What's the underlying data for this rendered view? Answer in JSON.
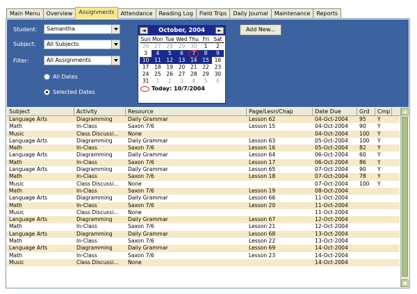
{
  "tabs": [
    {
      "label": "Main Menu"
    },
    {
      "label": "Overview"
    },
    {
      "label": "Assignments",
      "active": true
    },
    {
      "label": "Attendance"
    },
    {
      "label": "Reading Log"
    },
    {
      "label": "Field Trips"
    },
    {
      "label": "Daily Journal"
    },
    {
      "label": "Maintenance"
    },
    {
      "label": "Reports"
    }
  ],
  "filters": {
    "student_label": "Student:",
    "student_value": "Samantha",
    "subject_label": "Subject:",
    "subject_value": "All Subjects",
    "filter_label": "Filter:",
    "filter_value": "All Assignments",
    "radio_all": "All Dates",
    "radio_selected": "Selected Dates"
  },
  "add_new_label": "Add New...",
  "calendar": {
    "prev": "◄",
    "next": "►",
    "title": "October, 2004",
    "day_names": [
      "Sun",
      "Mon",
      "Tue",
      "Wed",
      "Thu",
      "Fri",
      "Sat"
    ],
    "days": [
      [
        "26",
        "27",
        "28",
        "29",
        "30",
        "1",
        "2"
      ],
      [
        "3",
        "4",
        "5",
        "6",
        "7",
        "8",
        "9"
      ],
      [
        "10",
        "11",
        "12",
        "13",
        "14",
        "15",
        "16"
      ],
      [
        "17",
        "18",
        "19",
        "20",
        "21",
        "22",
        "23"
      ],
      [
        "24",
        "25",
        "26",
        "27",
        "28",
        "29",
        "30"
      ],
      [
        "31",
        "1",
        "2",
        "3",
        "4",
        "5",
        "6"
      ]
    ],
    "today_label": "Today: 10/7/2004"
  },
  "table": {
    "headers": [
      "Subject",
      "Activity",
      "Resource",
      "Page/Lesn/Chap",
      "Date Due",
      "Grd",
      "Cmp"
    ],
    "rows": [
      [
        "Language Arts",
        "Diagramming",
        "Daily Grammar",
        "Lesson 62",
        "04-Oct-2004",
        "95",
        "Y"
      ],
      [
        "Math",
        "In-Class",
        "Saxon 7/6",
        "Lesson 15",
        "04-Oct-2004",
        "90",
        "Y"
      ],
      [
        "Music",
        "Class Discussi...",
        "None",
        "",
        "04-Oct-2004",
        "100",
        "Y"
      ],
      [
        "Language Arts",
        "Diagramming",
        "Daily Grammar",
        "Lesson 63",
        "05-Oct-2004",
        "100",
        "Y"
      ],
      [
        "Math",
        "In-Class",
        "Saxon 7/6",
        "Lesson 16",
        "05-Oct-2004",
        "82",
        "Y"
      ],
      [
        "Language Arts",
        "Diagramming",
        "Daily Grammar",
        "Lesson 64",
        "06-Oct-2004",
        "60",
        "Y"
      ],
      [
        "Math",
        "In-Class",
        "Saxon 7/6",
        "Lesson 17",
        "06-Oct-2004",
        "86",
        "Y"
      ],
      [
        "Language Arts",
        "Diagramming",
        "Daily Grammar",
        "Lesson 65",
        "07-Oct-2004",
        "90",
        "Y"
      ],
      [
        "Math",
        "In-Class",
        "Saxon 7/6",
        "Lesson 18",
        "07-Oct-2004",
        "78",
        "Y"
      ],
      [
        "Music",
        "Class Discussi...",
        "None",
        "",
        "07-Oct-2004",
        "100",
        "Y"
      ],
      [
        "Math",
        "In-Class",
        "Saxon 7/6",
        "Lesson 19",
        "08-Oct-2004",
        "",
        ""
      ],
      [
        "Language Arts",
        "Diagramming",
        "Daily Grammar",
        "Lesson 66",
        "11-Oct-2004",
        "",
        ""
      ],
      [
        "Math",
        "In-Class",
        "Saxon 7/6",
        "Lesson 20",
        "11-Oct-2004",
        "",
        ""
      ],
      [
        "Music",
        "Class Discussi...",
        "None",
        "",
        "11-Oct-2004",
        "",
        ""
      ],
      [
        "Language Arts",
        "Diagramming",
        "Daily Grammar",
        "Lesson 67",
        "12-Oct-2004",
        "",
        ""
      ],
      [
        "Math",
        "In-Class",
        "Saxon 7/6",
        "Lesson 21",
        "12-Oct-2004",
        "",
        ""
      ],
      [
        "Language Arts",
        "Diagramming",
        "Daily Grammar",
        "Lesson 68",
        "13-Oct-2004",
        "",
        ""
      ],
      [
        "Math",
        "In-Class",
        "Saxon 7/6",
        "Lesson 22",
        "13-Oct-2004",
        "",
        ""
      ],
      [
        "Language Arts",
        "Diagramming",
        "Daily Grammar",
        "Lesson 69",
        "14-Oct-2004",
        "",
        ""
      ],
      [
        "Math",
        "In-Class",
        "Saxon 7/6",
        "Lesson 23",
        "14-Oct-2004",
        "",
        ""
      ],
      [
        "Music",
        "Class Discussi...",
        "None",
        "",
        "14-Oct-2004",
        "",
        ""
      ]
    ]
  },
  "colors": {
    "panel_blue": "#3c639f",
    "calendar_header": "#1a2a8c",
    "row_alt": "#f6e9c6",
    "active_tab": "#f7e98a",
    "today_circle": "#e02020"
  }
}
